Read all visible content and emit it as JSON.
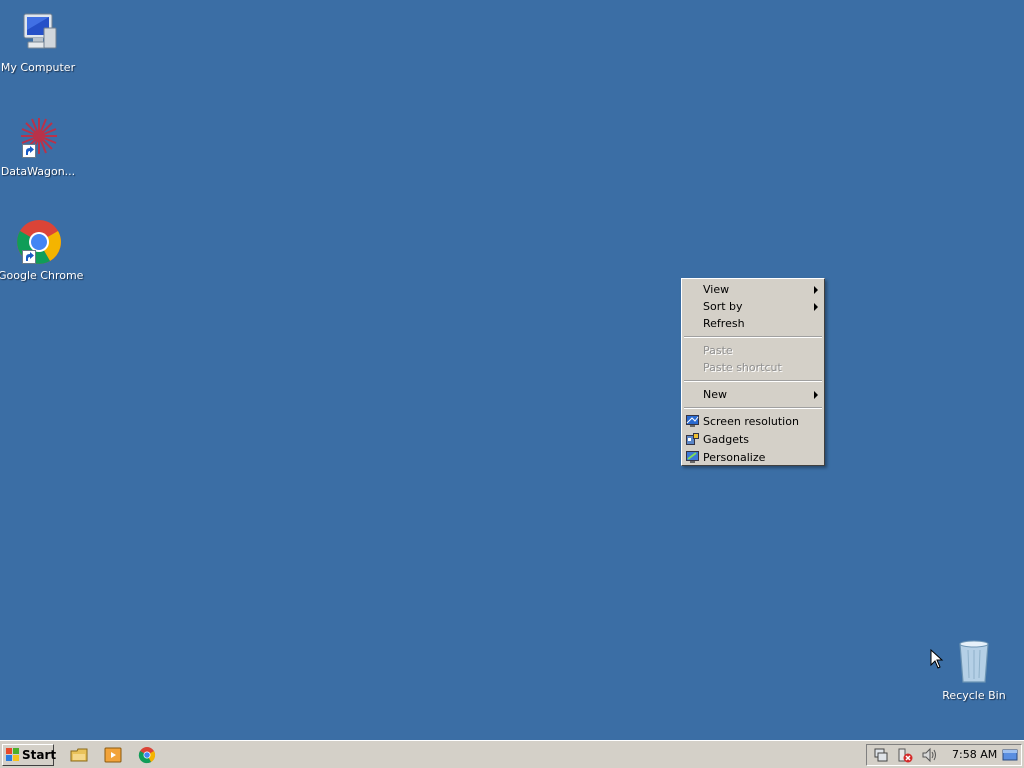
{
  "desktop": {
    "background": "#3b6ea5",
    "icons": [
      {
        "label": "My Computer",
        "icon": "my-computer-icon"
      },
      {
        "label": "DataWagon...",
        "icon": "datawagon-icon"
      },
      {
        "label": "Google Chrome",
        "icon": "chrome-icon"
      },
      {
        "label": "Recycle Bin",
        "icon": "recycle-bin-icon"
      }
    ]
  },
  "context_menu": {
    "items": [
      {
        "label": "View",
        "submenu": true,
        "enabled": true
      },
      {
        "label": "Sort by",
        "submenu": true,
        "enabled": true
      },
      {
        "label": "Refresh",
        "enabled": true
      },
      {
        "label": "Paste",
        "enabled": false
      },
      {
        "label": "Paste shortcut",
        "enabled": false
      },
      {
        "label": "New",
        "submenu": true,
        "enabled": true
      },
      {
        "label": "Screen resolution",
        "icon": "screen-resolution-icon",
        "enabled": true
      },
      {
        "label": "Gadgets",
        "icon": "gadgets-icon",
        "enabled": true
      },
      {
        "label": "Personalize",
        "icon": "personalize-icon",
        "enabled": true
      }
    ]
  },
  "taskbar": {
    "start_label": "Start",
    "quick_launch": [
      "explorer-icon",
      "media-player-icon",
      "chrome-icon"
    ],
    "tray_icons": [
      "network-icon",
      "action-center-icon",
      "volume-icon",
      "show-desktop-icon"
    ],
    "clock": "7:58 AM"
  }
}
